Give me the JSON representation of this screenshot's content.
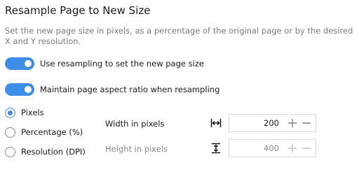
{
  "title": "Resample Page to New Size",
  "description": "Set the new page size in pixels, as a percentage of the original page or by the desired X and Y resolution.",
  "toggles": [
    {
      "label": "Use resampling to set the new page size",
      "on": true
    },
    {
      "label": "Maintain page aspect ratio when resampling",
      "on": true
    }
  ],
  "modes": [
    {
      "label": "Pixels",
      "selected": true
    },
    {
      "label": "Percentage (%)",
      "selected": false
    },
    {
      "label": "Resolution (DPI)",
      "selected": false
    }
  ],
  "width": {
    "label": "Width in pixels",
    "value": "200",
    "enabled": true,
    "icon": "horizontal-resize-icon"
  },
  "height": {
    "label": "Height in pixels",
    "value": "400",
    "enabled": false,
    "icon": "vertical-resize-icon"
  },
  "colors": {
    "accent": "#3d8ee8",
    "disabled": "#8a8a8a"
  }
}
